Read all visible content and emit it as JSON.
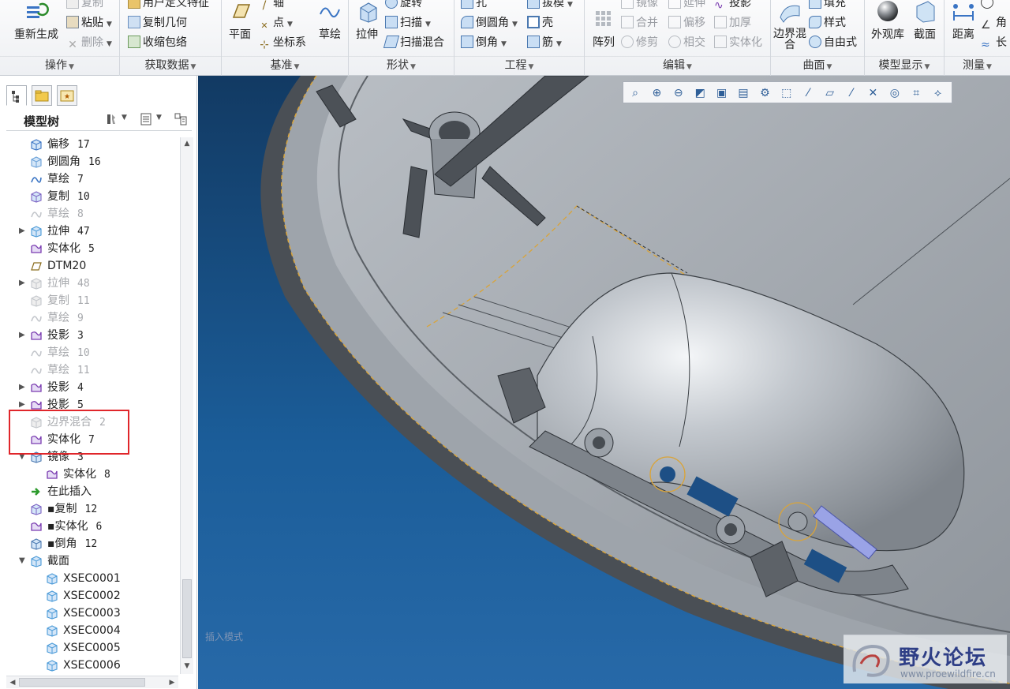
{
  "ribbon": {
    "groups": [
      {
        "label": "操作"
      },
      {
        "label": "获取数据"
      },
      {
        "label": "基准"
      },
      {
        "label": "形状"
      },
      {
        "label": "工程"
      },
      {
        "label": "编辑"
      },
      {
        "label": "曲面"
      },
      {
        "label": "模型显示"
      },
      {
        "label": "测量"
      }
    ],
    "buttons": {
      "regenerate": "重新生成",
      "copy": "复制",
      "paste": "粘贴",
      "delete": "删除",
      "user_feature": "用户定义特征",
      "copy_geometry": "复制几何",
      "shrinkwrap": "收缩包络",
      "plane": "平面",
      "axis": "轴",
      "point": "点",
      "csys": "坐标系",
      "sketch": "草绘",
      "extrude": "拉伸",
      "revolve": "旋转",
      "sweep": "扫描",
      "swept_blend": "扫描混合",
      "hole": "孔",
      "round": "倒圆角",
      "chamfer": "倒角",
      "draft": "拔模",
      "shell": "壳",
      "rib": "筋",
      "pattern": "阵列",
      "mirror": "镜像",
      "merge": "合并",
      "trim": "修剪",
      "extend": "延伸",
      "offset": "偏移",
      "intersect": "相交",
      "project": "投影",
      "thicken": "加厚",
      "solidify": "实体化",
      "boundary_blend": "边界混合",
      "fill": "填充",
      "style": "样式",
      "freestyle": "自由式",
      "appearance": "外观库",
      "section": "截面",
      "distance": "距离",
      "angle": "角",
      "length": "长"
    }
  },
  "model_tree": {
    "title": "模型树",
    "items": [
      {
        "label": "偏移",
        "num": "17",
        "icon": "offset-icon",
        "dim": false,
        "expand": ""
      },
      {
        "label": "倒圆角",
        "num": "16",
        "icon": "round-icon",
        "dim": false,
        "expand": ""
      },
      {
        "label": "草绘",
        "num": "7",
        "icon": "sketch-icon",
        "dim": false,
        "expand": ""
      },
      {
        "label": "复制",
        "num": "10",
        "icon": "copy-icon",
        "dim": false,
        "expand": ""
      },
      {
        "label": "草绘",
        "num": "8",
        "icon": "sketch-icon",
        "dim": true,
        "expand": ""
      },
      {
        "label": "拉伸",
        "num": "47",
        "icon": "extrude-icon",
        "dim": false,
        "expand": "▶"
      },
      {
        "label": "实体化",
        "num": "5",
        "icon": "solidify-icon",
        "dim": false,
        "expand": ""
      },
      {
        "label": "DTM20",
        "num": "",
        "icon": "datum-plane-icon",
        "dim": false,
        "expand": ""
      },
      {
        "label": "拉伸",
        "num": "48",
        "icon": "extrude-icon",
        "dim": true,
        "expand": "▶"
      },
      {
        "label": "复制",
        "num": "11",
        "icon": "copy-icon",
        "dim": true,
        "expand": ""
      },
      {
        "label": "草绘",
        "num": "9",
        "icon": "sketch-icon",
        "dim": true,
        "expand": ""
      },
      {
        "label": "投影",
        "num": "3",
        "icon": "project-icon",
        "dim": false,
        "expand": "▶"
      },
      {
        "label": "草绘",
        "num": "10",
        "icon": "sketch-icon",
        "dim": true,
        "expand": ""
      },
      {
        "label": "草绘",
        "num": "11",
        "icon": "sketch-icon",
        "dim": true,
        "expand": ""
      },
      {
        "label": "投影",
        "num": "4",
        "icon": "project-icon",
        "dim": false,
        "expand": "▶"
      },
      {
        "label": "投影",
        "num": "5",
        "icon": "project-icon",
        "dim": false,
        "expand": "▶"
      },
      {
        "label": "边界混合",
        "num": "2",
        "icon": "boundary-blend-icon",
        "dim": true,
        "expand": ""
      },
      {
        "label": "实体化",
        "num": "7",
        "icon": "solidify-icon",
        "dim": false,
        "expand": ""
      },
      {
        "label": "镜像",
        "num": "3",
        "icon": "mirror-icon",
        "dim": false,
        "expand": "▼"
      },
      {
        "label": "实体化",
        "num": "8",
        "icon": "solidify-icon",
        "dim": false,
        "expand": "",
        "indent": true
      },
      {
        "label": "在此插入",
        "num": "",
        "icon": "insert-here-icon",
        "dim": false,
        "expand": ""
      },
      {
        "label": "▪复制",
        "num": "12",
        "icon": "copy-icon",
        "dim": false,
        "expand": ""
      },
      {
        "label": "▪实体化",
        "num": "6",
        "icon": "solidify-icon",
        "dim": false,
        "expand": ""
      },
      {
        "label": "▪倒角",
        "num": "12",
        "icon": "chamfer-icon",
        "dim": false,
        "expand": ""
      },
      {
        "label": "截面",
        "num": "",
        "icon": "section-icon",
        "dim": false,
        "expand": "▼"
      },
      {
        "label": "XSEC0001",
        "num": "",
        "icon": "xsec-icon",
        "dim": false,
        "expand": "",
        "indent": true
      },
      {
        "label": "XSEC0002",
        "num": "",
        "icon": "xsec-icon",
        "dim": false,
        "expand": "",
        "indent": true
      },
      {
        "label": "XSEC0003",
        "num": "",
        "icon": "xsec-icon",
        "dim": false,
        "expand": "",
        "indent": true
      },
      {
        "label": "XSEC0004",
        "num": "",
        "icon": "xsec-icon",
        "dim": false,
        "expand": "",
        "indent": true
      },
      {
        "label": "XSEC0005",
        "num": "",
        "icon": "xsec-icon",
        "dim": false,
        "expand": "",
        "indent": true
      },
      {
        "label": "XSEC0006",
        "num": "",
        "icon": "xsec-icon",
        "dim": false,
        "expand": "",
        "indent": true
      }
    ]
  },
  "viewport": {
    "mode_text": "插入模式",
    "toolbar_icons": [
      "refit-icon",
      "zoom-in-icon",
      "zoom-out-icon",
      "repaint-icon",
      "display-style-icon",
      "saved-views-icon",
      "view-manager-icon",
      "perspective-icon",
      "datum-axis-display-icon",
      "datum-plane-display-icon",
      "datum-point-display-icon",
      "csys-display-icon",
      "spin-center-icon",
      "annotation-display-icon",
      "sketch-display-icon"
    ],
    "watermark_title": "野火论坛",
    "watermark_url": "www.proewildfire.cn"
  },
  "colors": {
    "viewport_top": "#123a63",
    "viewport_bottom": "#2769a8",
    "highlight": "#e0262b",
    "model": "#a8adb3"
  }
}
